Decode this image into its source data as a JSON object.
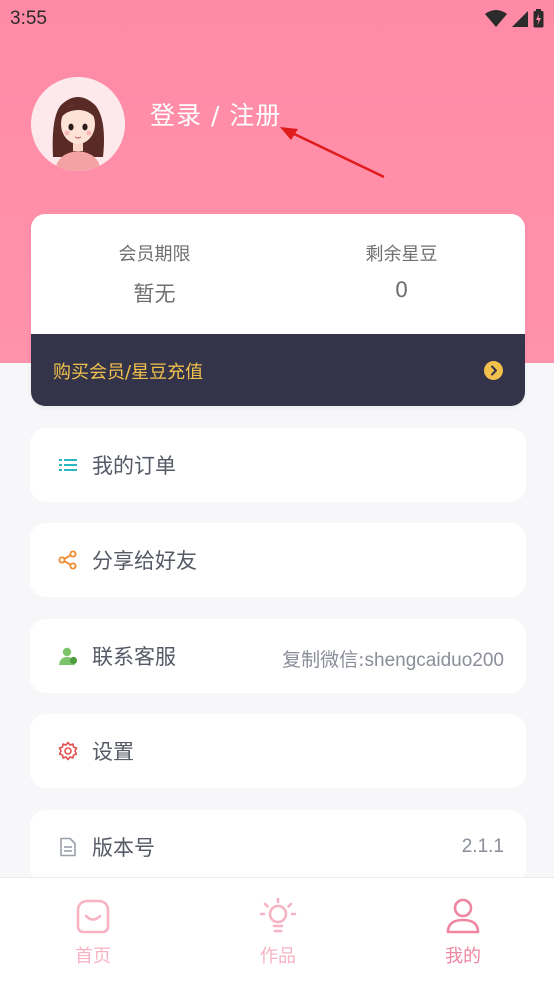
{
  "status_bar": {
    "time": "3:55",
    "icons": [
      "wifi-icon",
      "signal-icon",
      "battery-icon"
    ]
  },
  "profile": {
    "avatar_icon": "avatar-girl-icon",
    "login_label": "登录 / 注册"
  },
  "member_card": {
    "membership": {
      "label": "会员期限",
      "value": "暂无"
    },
    "beans": {
      "label": "剩余星豆",
      "value": "0"
    },
    "recharge_label": "购买会员/星豆充值"
  },
  "menu": {
    "orders": {
      "label": "我的订单",
      "icon": "list-icon"
    },
    "share": {
      "label": "分享给好友",
      "icon": "share-icon"
    },
    "support": {
      "label": "联系客服",
      "icon": "contact-icon",
      "value_prefix": "复制微信:",
      "value_id": "shengcaiduo200"
    },
    "settings": {
      "label": "设置",
      "icon": "gear-icon"
    },
    "version": {
      "label": "版本号",
      "icon": "document-icon",
      "value": "2.1.1"
    }
  },
  "tab_bar": {
    "tabs": [
      {
        "label": "首页",
        "icon": "home-smile-icon",
        "active": false
      },
      {
        "label": "作品",
        "icon": "lightbulb-icon",
        "active": false
      },
      {
        "label": "我的",
        "icon": "user-icon",
        "active": true
      }
    ]
  },
  "colors": {
    "hero": "#ff8aa6",
    "card_dark": "#333449",
    "gold": "#f2c14b",
    "tab_inactive": "#f7b3c4",
    "tab_active": "#ef86a2"
  }
}
